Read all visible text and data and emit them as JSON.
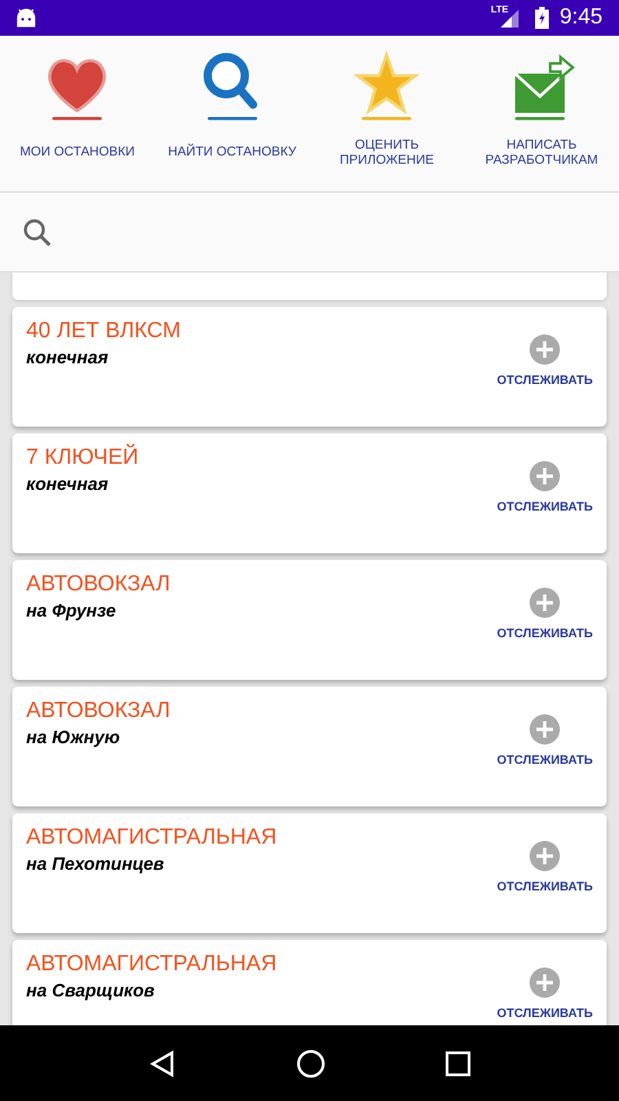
{
  "status_bar": {
    "network": "LTE",
    "time": "9:45"
  },
  "menu": [
    {
      "label": "МОИ ОСТАНОВКИ",
      "kind": "heart"
    },
    {
      "label": "НАЙТИ ОСТАНОВКУ",
      "kind": "search"
    },
    {
      "label": "ОЦЕНИТЬ ПРИЛОЖЕНИЕ",
      "kind": "star"
    },
    {
      "label": "НАПИСАТЬ РАЗРАБОТЧИКАМ",
      "kind": "mail"
    }
  ],
  "stops": [
    {
      "name": "40 ЛЕТ ВЛКСМ",
      "direction": "конечная",
      "action": "ОТСЛЕЖИВАТЬ"
    },
    {
      "name": "7 КЛЮЧЕЙ",
      "direction": "конечная",
      "action": "ОТСЛЕЖИВАТЬ"
    },
    {
      "name": "АВТОВОКЗАЛ",
      "direction": "на Фрунзе",
      "action": "ОТСЛЕЖИВАТЬ"
    },
    {
      "name": "АВТОВОКЗАЛ",
      "direction": "на Южную",
      "action": "ОТСЛЕЖИВАТЬ"
    },
    {
      "name": "АВТОМАГИСТРАЛЬНАЯ",
      "direction": "на Пехотинцев",
      "action": "ОТСЛЕЖИВАТЬ"
    },
    {
      "name": "АВТОМАГИСТРАЛЬНАЯ",
      "direction": "на Сварщиков",
      "action": "ОТСЛЕЖИВАТЬ"
    }
  ]
}
